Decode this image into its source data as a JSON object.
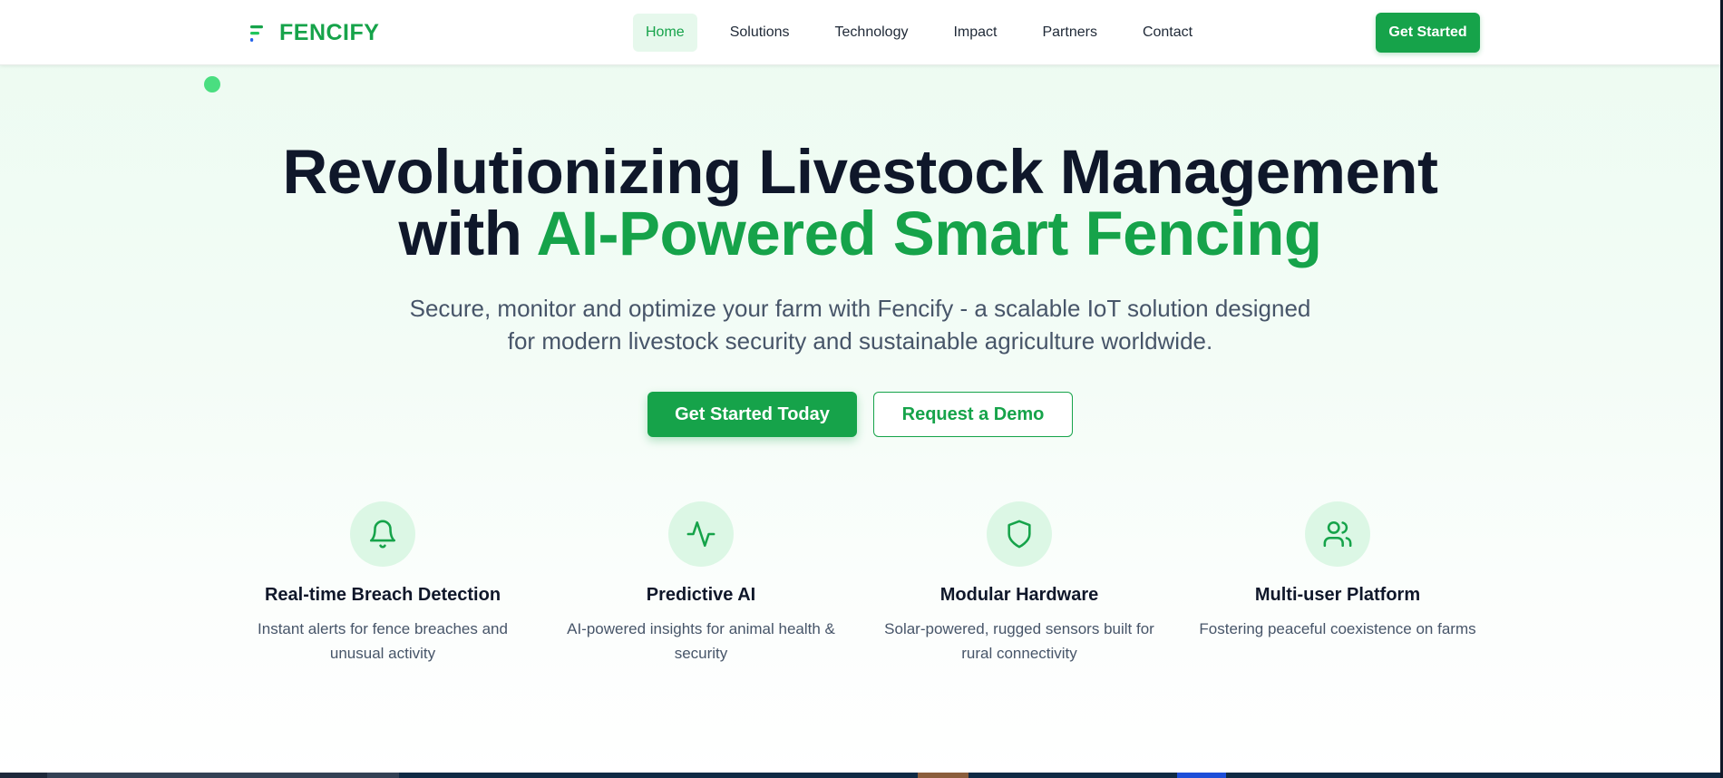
{
  "brand": {
    "name": "FENCIFY",
    "logo_icon": "logo-mark-icon",
    "primary_color": "#16a34a",
    "accent_light": "#dcf7e5"
  },
  "nav": {
    "items": [
      {
        "label": "Home",
        "active": true
      },
      {
        "label": "Solutions",
        "active": false
      },
      {
        "label": "Technology",
        "active": false
      },
      {
        "label": "Impact",
        "active": false
      },
      {
        "label": "Partners",
        "active": false
      },
      {
        "label": "Contact",
        "active": false
      }
    ],
    "cta_label": "Get Started"
  },
  "hero": {
    "title_line1": "Revolutionizing Livestock Management",
    "title_line2_prefix": "with ",
    "title_line2_accent": "AI-Powered Smart Fencing",
    "subtitle_line1": "Secure, monitor and optimize your farm with Fencify - a scalable IoT solution designed",
    "subtitle_line2": "for modern livestock security and sustainable agriculture worldwide.",
    "primary_button": "Get Started Today",
    "secondary_button": "Request a Demo"
  },
  "features": [
    {
      "icon": "bell-icon",
      "title": "Real-time Breach Detection",
      "desc_line1": "Instant alerts for fence breaches and",
      "desc_line2": "unusual activity"
    },
    {
      "icon": "activity-icon",
      "title": "Predictive AI",
      "desc_line1": "AI-powered insights for animal health &",
      "desc_line2": "security"
    },
    {
      "icon": "shield-icon",
      "title": "Modular Hardware",
      "desc_line1": "Solar-powered, rugged sensors built for",
      "desc_line2": "rural connectivity"
    },
    {
      "icon": "users-icon",
      "title": "Multi-user Platform",
      "desc_line1": "Fostering peaceful coexistence on farms",
      "desc_line2": ""
    }
  ]
}
